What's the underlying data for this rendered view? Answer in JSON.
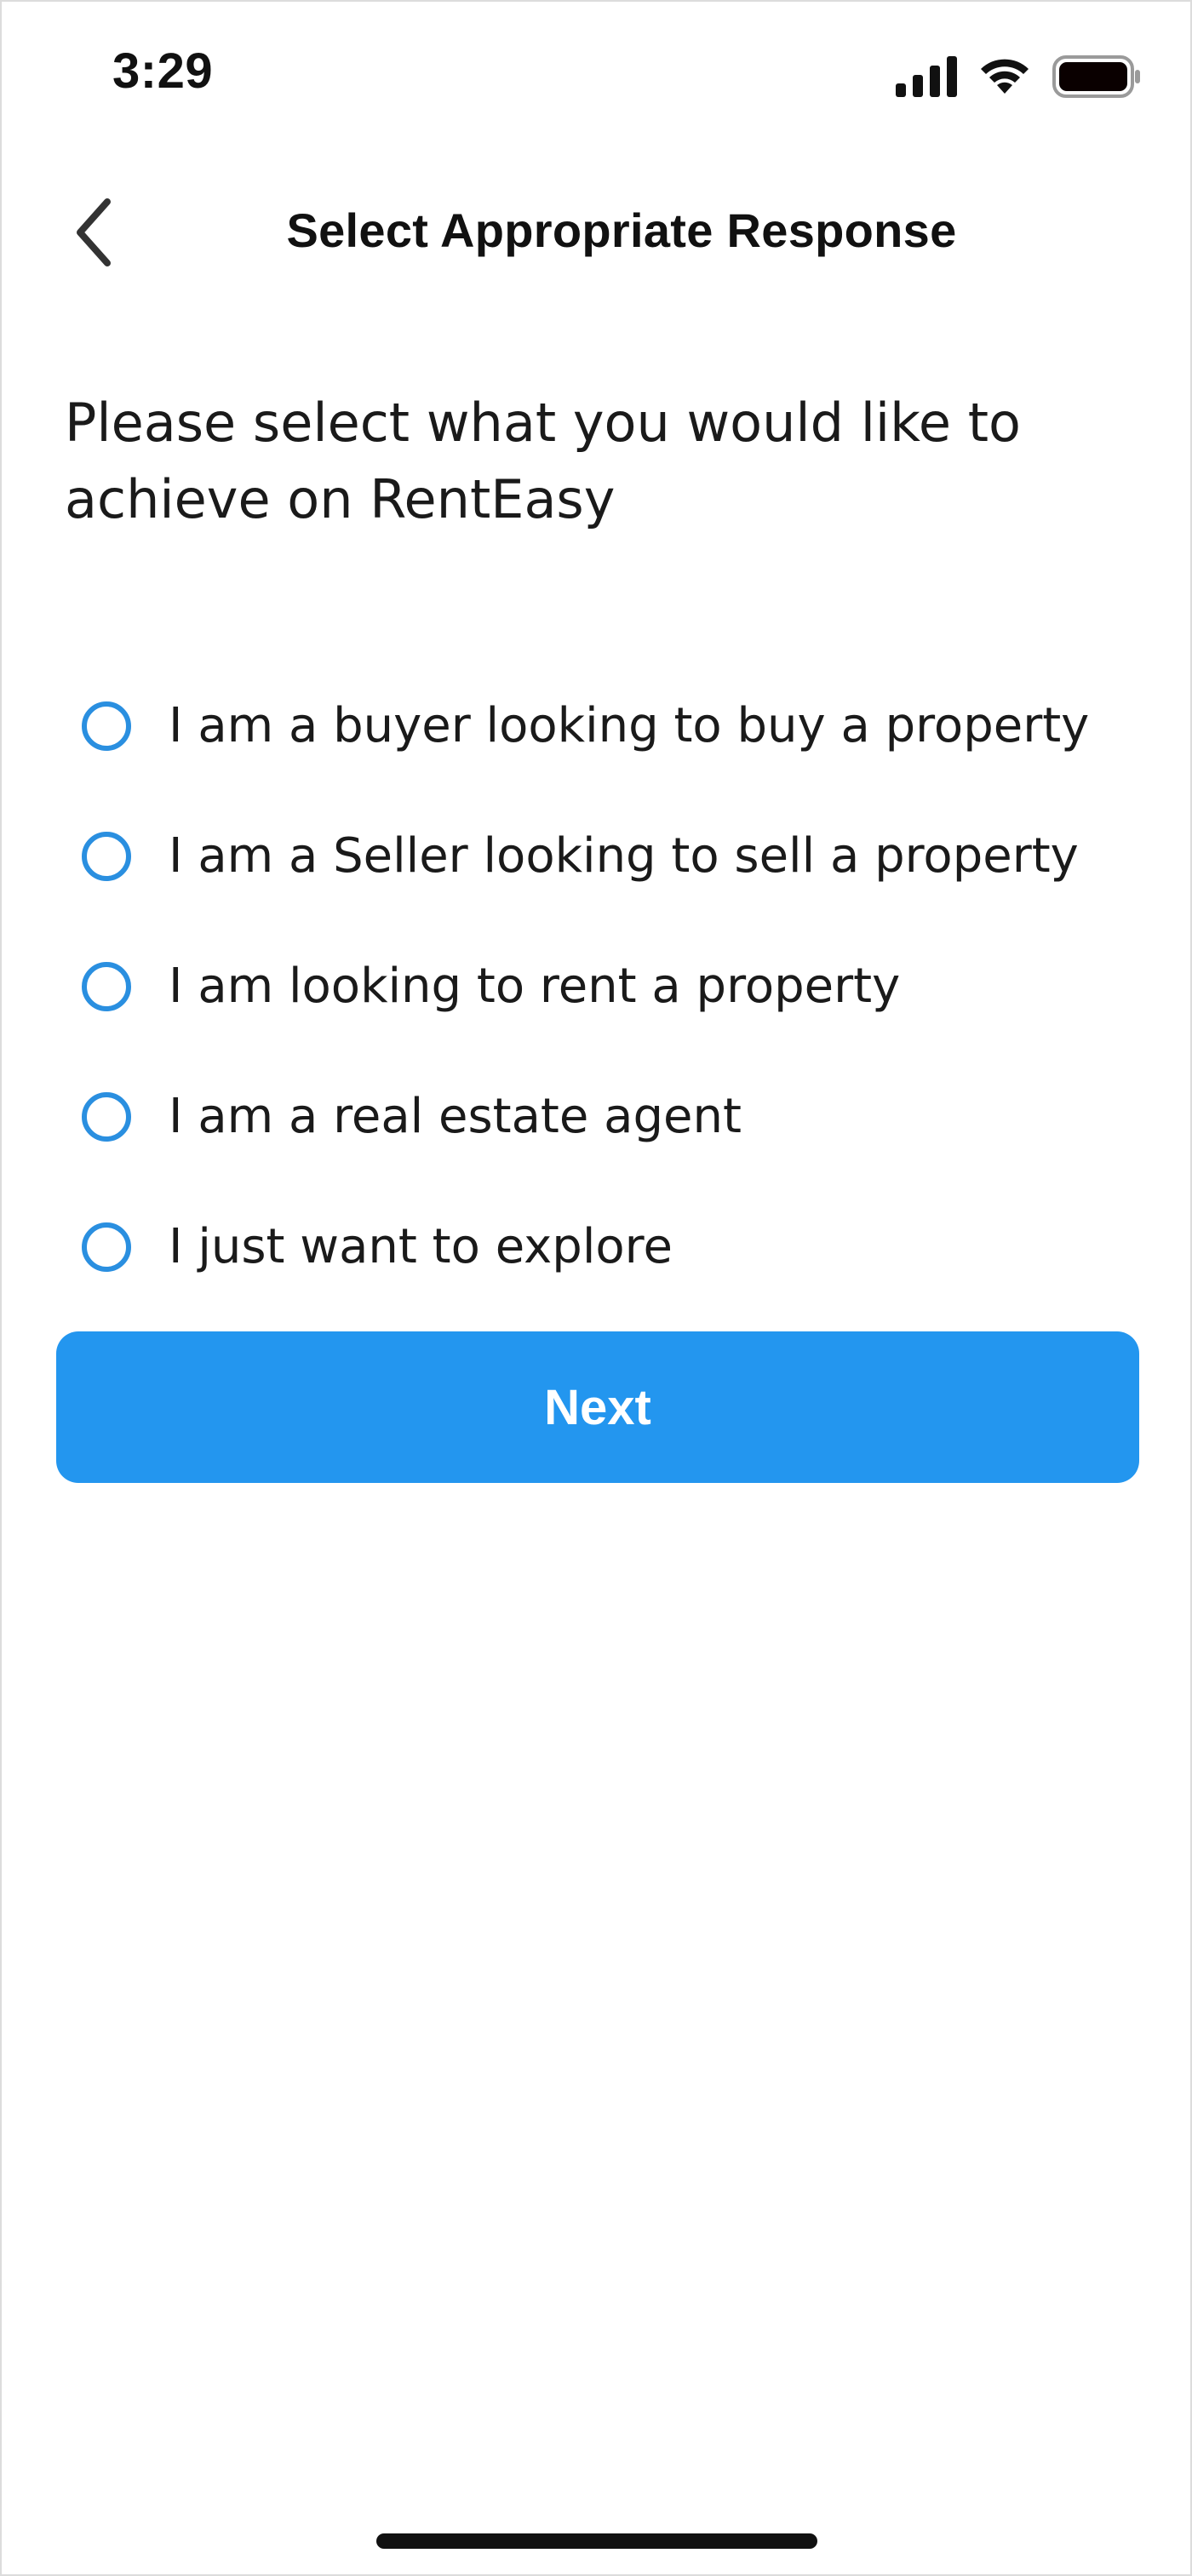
{
  "status_bar": {
    "time": "3:29",
    "icons": [
      "cellular-signal-icon",
      "wifi-icon",
      "battery-icon"
    ]
  },
  "header": {
    "title": "Select Appropriate Response",
    "back_icon": "chevron-left-icon"
  },
  "prompt": "Please select what you would like to achieve on RentEasy",
  "options": [
    {
      "label": "I am a buyer looking to buy a property",
      "selected": false
    },
    {
      "label": "I am a Seller looking to sell a property",
      "selected": false
    },
    {
      "label": "I am looking to rent a property",
      "selected": false
    },
    {
      "label": "I am a real estate agent",
      "selected": false
    },
    {
      "label": "I just want to explore",
      "selected": false
    }
  ],
  "next_button": {
    "label": "Next"
  },
  "colors": {
    "accent": "#2396ef",
    "radio_border": "#2a8fe0",
    "text": "#1a1a1a",
    "background": "#ffffff"
  }
}
